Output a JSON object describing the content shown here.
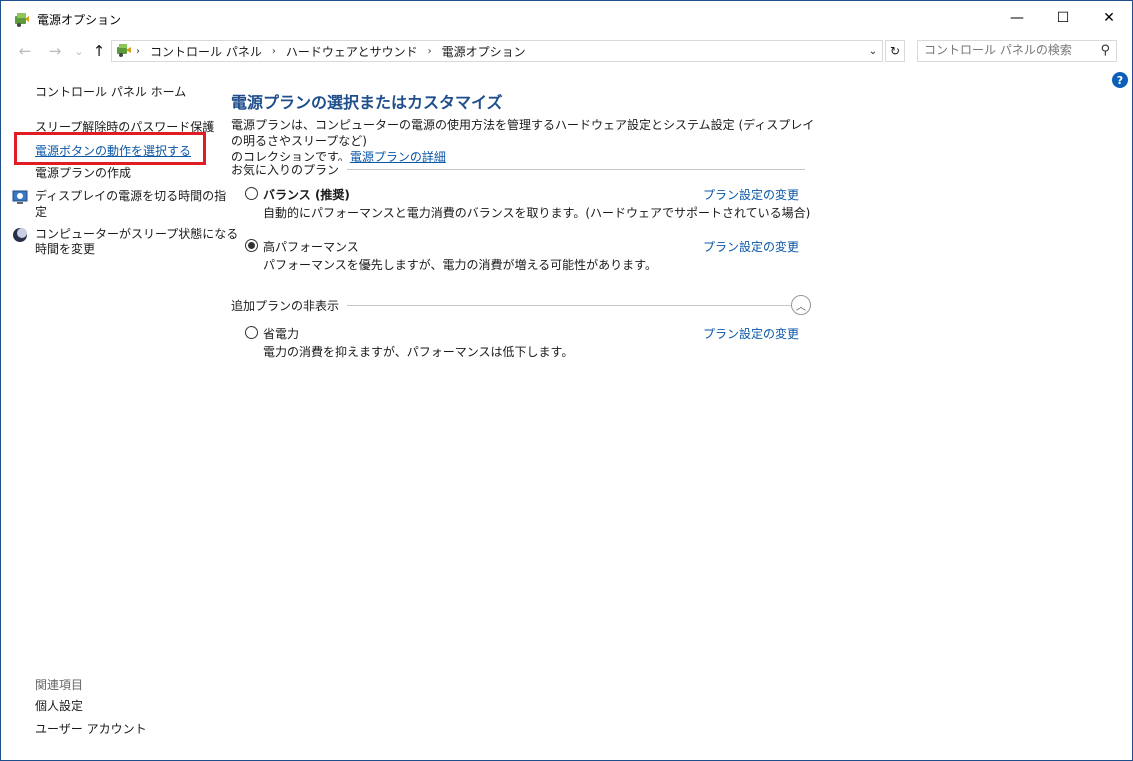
{
  "window": {
    "title": "電源オプション",
    "controls": {
      "minimize": "—",
      "maximize": "☐",
      "close": "✕"
    }
  },
  "nav": {
    "back": "←",
    "forward": "→",
    "recent": "⌄",
    "up": "↑",
    "breadcrumbs": [
      "コントロール パネル",
      "ハードウェアとサウンド",
      "電源オプション"
    ],
    "separator": "›",
    "dropdown": "⌄",
    "refresh": "↻",
    "search_placeholder": "コントロール パネルの検索",
    "search_icon": "⚲"
  },
  "help": "?",
  "sidebar": {
    "home": "コントロール パネル ホーム",
    "items": [
      "スリープ解除時のパスワード保護",
      "電源ボタンの動作を選択する",
      "電源プランの作成",
      "ディスプレイの電源を切る時間の指定",
      "コンピューターがスリープ状態になる時間を変更"
    ],
    "item4_line1": "ディスプレイの電源を切る時間の指",
    "item4_line2": "定",
    "item5_line1": "コンピューターがスリープ状態になる",
    "item5_line2": "時間を変更",
    "related_title": "関連項目",
    "related": [
      "個人設定",
      "ユーザー アカウント"
    ]
  },
  "main": {
    "title": "電源プランの選択またはカスタマイズ",
    "desc_line1": "電源プランは、コンピューターの電源の使用方法を管理するハードウェア設定とシステム設定 (ディスプレイの明るさやスリープなど)",
    "desc_line2": "のコレクションです。",
    "desc_link": "電源プランの詳細",
    "favorites_label": "お気に入りのプラン",
    "hidden_label": "追加プランの非表示",
    "collapse": "︿",
    "plans": [
      {
        "name": "バランス (推奨)",
        "desc": "自動的にパフォーマンスと電力消費のバランスを取ります。(ハードウェアでサポートされている場合)",
        "link": "プラン設定の変更",
        "checked": false
      },
      {
        "name": "高パフォーマンス",
        "desc": "パフォーマンスを優先しますが、電力の消費が増える可能性があります。",
        "link": "プラン設定の変更",
        "checked": true
      },
      {
        "name": "省電力",
        "desc": "電力の消費を抑えますが、パフォーマンスは低下します。",
        "link": "プラン設定の変更",
        "checked": false
      }
    ]
  },
  "colors": {
    "link": "#0b57a7",
    "title": "#1f4e8c",
    "highlight": "#e01c24"
  }
}
